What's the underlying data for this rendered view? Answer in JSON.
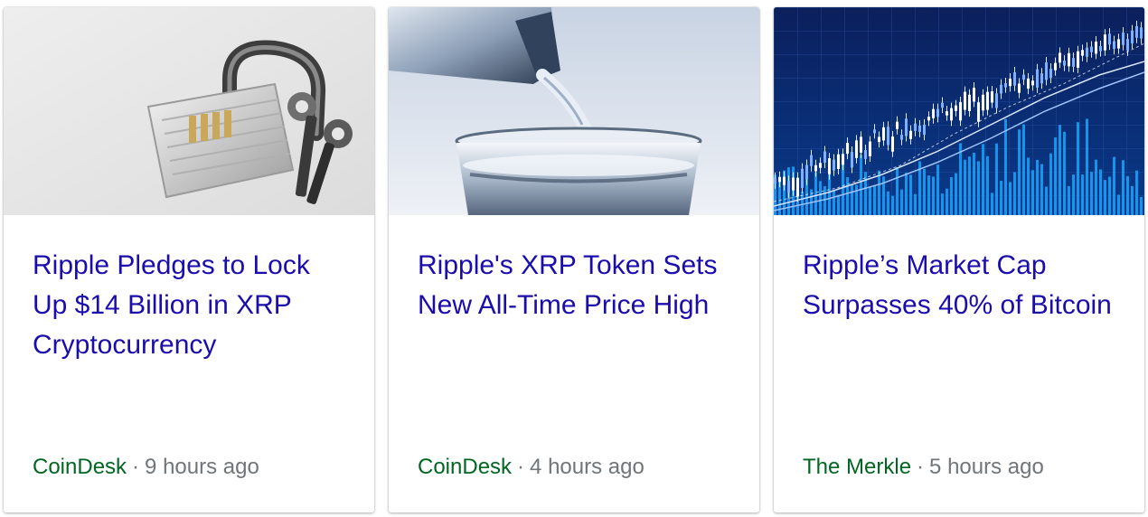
{
  "cards": [
    {
      "image": "padlock-with-keys",
      "title": "Ripple Pledges to Lock Up $14 Billion in XRP Cryptocurrency",
      "source": "CoinDesk",
      "separator": "·",
      "time": "9 hours ago"
    },
    {
      "image": "water-pouring-into-glass",
      "title": "Ripple's XRP Token Sets New All-Time Price High",
      "source": "CoinDesk",
      "separator": "·",
      "time": "4 hours ago"
    },
    {
      "image": "stock-candlestick-chart",
      "title": "Ripple’s Market Cap Surpasses 40% of Bitcoin",
      "source": "The Merkle",
      "separator": "·",
      "time": "5 hours ago"
    }
  ],
  "colors": {
    "title": "#1a0dab",
    "source": "#006621",
    "meta": "#70757a",
    "chart_background": "#0a2a7a"
  }
}
